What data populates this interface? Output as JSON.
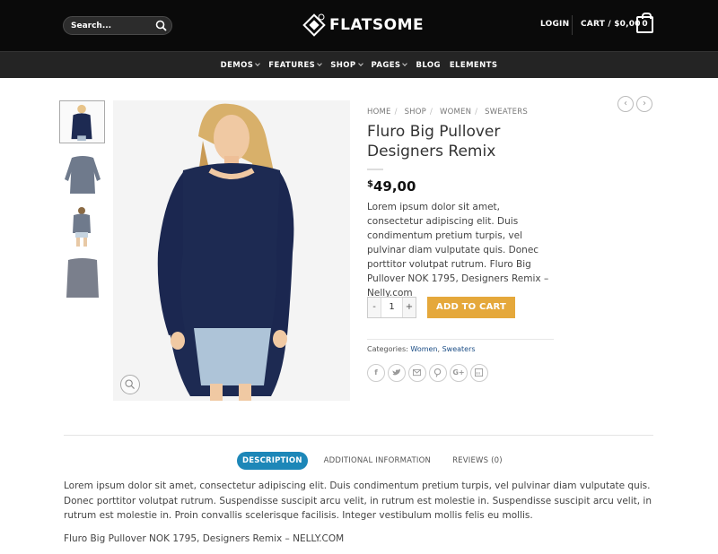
{
  "header": {
    "search_placeholder": "Search...",
    "logo_text": "FLATSOME",
    "login_label": "LOGIN",
    "cart_label": "CART / $0,00",
    "cart_count": "0"
  },
  "nav": {
    "items": [
      {
        "label": "DEMOS",
        "dropdown": true
      },
      {
        "label": "FEATURES",
        "dropdown": true
      },
      {
        "label": "SHOP",
        "dropdown": true
      },
      {
        "label": "PAGES",
        "dropdown": true
      },
      {
        "label": "BLOG",
        "dropdown": false
      },
      {
        "label": "ELEMENTS",
        "dropdown": false
      }
    ]
  },
  "breadcrumb": [
    "HOME",
    "SHOP",
    "WOMEN",
    "SWEATERS"
  ],
  "breadcrumb_sep": "/",
  "product": {
    "title": "Fluro Big Pullover Designers Remix",
    "currency": "$",
    "price": "49,00",
    "short_description": "Lorem ipsum dolor sit amet, consectetur adipiscing elit. Duis condimentum pretium turpis, vel pulvinar diam vulputate quis. Donec porttitor volutpat rutrum. Fluro Big Pullover NOK 1795, Designers Remix – Nelly.com",
    "quantity": "1",
    "qty_minus": "-",
    "qty_plus": "+",
    "add_to_cart_label": "ADD TO CART",
    "categories_label": "Categories:",
    "categories": [
      "Women",
      "Sweaters"
    ],
    "share_icons": [
      "facebook-icon",
      "twitter-icon",
      "email-icon",
      "pinterest-icon",
      "googleplus-icon",
      "linkedin-icon"
    ]
  },
  "tabs": {
    "items": [
      "DESCRIPTION",
      "ADDITIONAL INFORMATION",
      "REVIEWS (0)"
    ],
    "active_index": 0,
    "description": "Lorem ipsum dolor sit amet, consectetur adipiscing elit. Duis condimentum pretium turpis, vel pulvinar diam vulputate quis. Donec porttitor volutpat rutrum. Suspendisse suscipit arcu velit, in rutrum est molestie in. Suspendisse suscipit arcu velit, in rutrum est molestie in. Proin convallis scelerisque facilisis. Integer vestibulum mollis felis eu mollis.",
    "description_line2": "Fluro Big Pullover NOK 1795, Designers Remix – NELLY.COM"
  },
  "colors": {
    "header_bg": "#0a0a0a",
    "nav_bg": "#242424",
    "accent": "#e5a83b",
    "tab_active": "#1d87b8",
    "link": "#1c4e86"
  }
}
